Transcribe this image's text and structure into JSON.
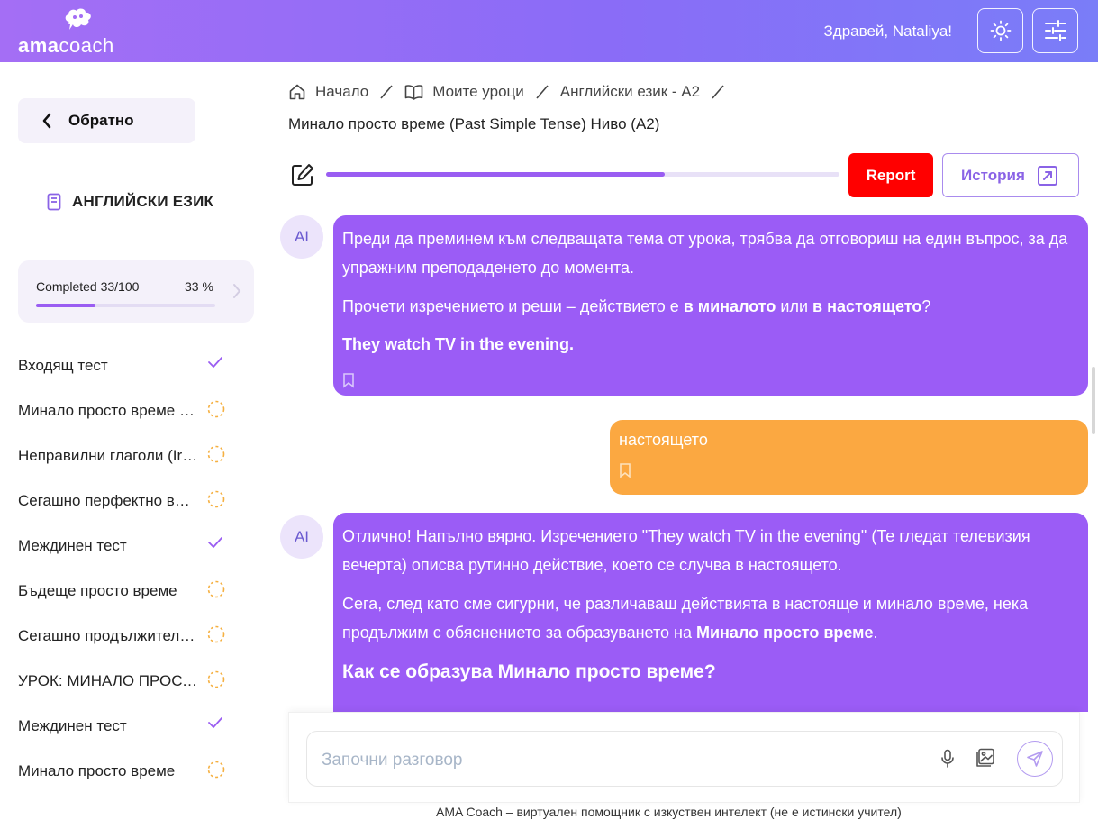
{
  "header": {
    "logo_ama": "AMA",
    "logo_coach": "Coach",
    "greeting": "Здравей, Nataliya!"
  },
  "sidebar": {
    "back_label": "Обратно",
    "course_title": "АНГЛИЙСКИ ЕЗИК",
    "progress": {
      "label": "Completed 33/100",
      "percent_text": "33 %",
      "fraction": 0.33
    },
    "lessons": [
      {
        "title": "Входящ тест",
        "status": "done"
      },
      {
        "title": "Минало просто време (Past Simple Tense)",
        "status": "pending"
      },
      {
        "title": "Неправилни глаголи (Irregular Verbs)",
        "status": "pending"
      },
      {
        "title": "Сегашно перфектно време",
        "status": "pending"
      },
      {
        "title": "Междинен тест",
        "status": "done"
      },
      {
        "title": "Бъдеще просто време",
        "status": "pending"
      },
      {
        "title": "Сегашно продължително време",
        "status": "pending"
      },
      {
        "title": "УРОК: МИНАЛО ПРОСТО ВРЕМЕ",
        "status": "pending"
      },
      {
        "title": "Междинен тест",
        "status": "done"
      },
      {
        "title": "Минало просто време",
        "status": "pending"
      }
    ]
  },
  "breadcrumb": {
    "home": "Начало",
    "my_lessons": "Моите уроци",
    "course": "Английски език - А2"
  },
  "lesson_title": "Минало просто време (Past Simple Tense) Ниво (А2)",
  "lesson_progress": 0.66,
  "toolbar": {
    "report_label": "Report",
    "history_label": "История"
  },
  "messages": {
    "ai_1": {
      "avatar": "AI",
      "p1": "Преди да преминем към следващата тема от урока, трябва да отговориш на един въпрос, за да упражним преподаденето до момента.",
      "p2_a": "Прочети изречението и реши – действието е ",
      "p2_b": "в миналото",
      "p2_c": " или ",
      "p2_d": "в настоящето",
      "p2_e": "?",
      "p3": "They watch TV in the evening."
    },
    "user_1": {
      "text": "настоящето"
    },
    "ai_2": {
      "avatar": "AI",
      "p1": "Отлично! Напълно вярно. Изречението \"They watch TV in the evening\" (Те гледат телевизия вечерта) описва рутинно действие, което се случва в настоящето.",
      "p2_a": "Сега, след като сме сигурни, че различаваш действията в настояще и минало време, нека продължим с обяснението за образуването на ",
      "p2_b": "Минало просто време",
      "p2_c": ".",
      "heading": "Как се образува Минало просто време?"
    }
  },
  "composer": {
    "placeholder": "Започни разговор"
  },
  "footer_note": "AMA Coach – виртуален помощник с изкуствен интелект (не е истински учител)",
  "colors": {
    "accent": "#9b5cf6",
    "user_bubble": "#fba841",
    "report": "#ff0000",
    "pending_status": "#f5b041"
  }
}
